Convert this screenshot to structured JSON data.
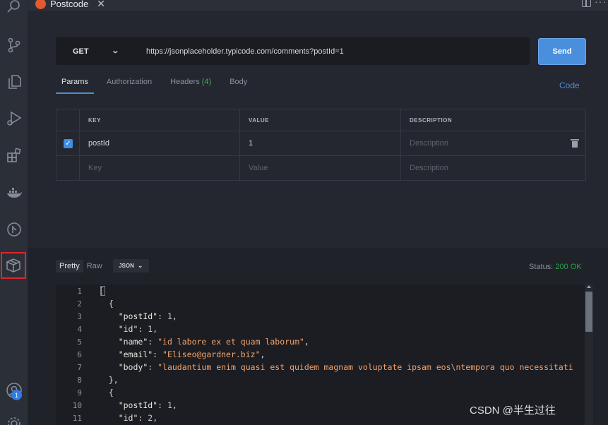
{
  "activity_bar": {
    "icons": [
      "search-icon",
      "source-control-icon",
      "explorer-icon",
      "run-debug-icon",
      "extensions-icon",
      "docker-icon",
      "git-graph-icon",
      "postcode-package-icon",
      "account-icon",
      "settings-gear-icon"
    ],
    "account_badge": "1"
  },
  "tab": {
    "title": "Postcode",
    "close": "✕"
  },
  "request": {
    "method": "GET",
    "url": "https://jsonplaceholder.typicode.com/comments?postId=1",
    "send_label": "Send",
    "tabs": [
      {
        "label": "Params",
        "active": true
      },
      {
        "label": "Authorization"
      },
      {
        "label": "Headers",
        "count": "(4)"
      },
      {
        "label": "Body"
      }
    ],
    "code_link": "Code",
    "params_table": {
      "headers": [
        "KEY",
        "VALUE",
        "DESCRIPTION"
      ],
      "rows": [
        {
          "checked": true,
          "key": "postId",
          "value": "1",
          "description_placeholder": "Description"
        }
      ],
      "empty_row": {
        "key_placeholder": "Key",
        "value_placeholder": "Value",
        "description_placeholder": "Description"
      }
    }
  },
  "response": {
    "view_pretty": "Pretty",
    "view_raw": "Raw",
    "format": "JSON",
    "status_label": "Status:",
    "status_value": "200 OK",
    "lines": [
      {
        "n": "1",
        "indent": "",
        "text": "["
      },
      {
        "n": "2",
        "indent": "  ",
        "text": "{"
      },
      {
        "n": "3",
        "indent": "    ",
        "key": "\"postId\"",
        "val": "1",
        "type": "num"
      },
      {
        "n": "4",
        "indent": "    ",
        "key": "\"id\"",
        "val": "1",
        "type": "num"
      },
      {
        "n": "5",
        "indent": "    ",
        "key": "\"name\"",
        "val": "\"id labore ex et quam laborum\"",
        "type": "str"
      },
      {
        "n": "6",
        "indent": "    ",
        "key": "\"email\"",
        "val": "\"Eliseo@gardner.biz\"",
        "type": "str"
      },
      {
        "n": "7",
        "indent": "    ",
        "key": "\"body\"",
        "val": "\"laudantium enim quasi est quidem magnam voluptate ipsam eos\\ntempora quo necessitati",
        "type": "str",
        "last": true
      },
      {
        "n": "8",
        "indent": "  ",
        "text": "},"
      },
      {
        "n": "9",
        "indent": "  ",
        "text": "{"
      },
      {
        "n": "10",
        "indent": "    ",
        "key": "\"postId\"",
        "val": "1",
        "type": "num"
      },
      {
        "n": "11",
        "indent": "    ",
        "key": "\"id\"",
        "val": "2",
        "type": "num"
      }
    ]
  },
  "watermark": "CSDN @半生过往"
}
